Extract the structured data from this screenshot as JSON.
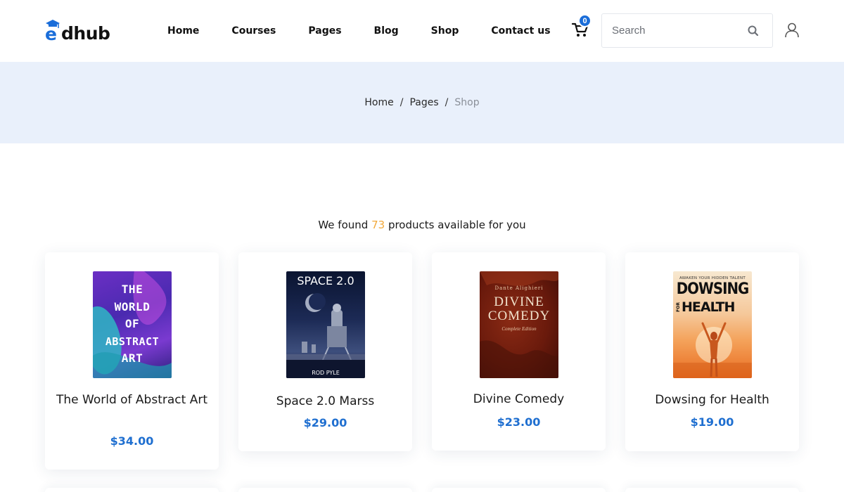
{
  "brand": {
    "logo_text": "dhub",
    "logo_letter": "e"
  },
  "nav": {
    "items": [
      "Home",
      "Courses",
      "Pages",
      "Blog",
      "Shop",
      "Contact us"
    ]
  },
  "cart": {
    "count": "0"
  },
  "search": {
    "placeholder": "Search"
  },
  "breadcrumb": {
    "home": "Home",
    "separator": "/",
    "pages": "Pages",
    "current": "Shop"
  },
  "results": {
    "prefix": "We found",
    "count": "73",
    "suffix": "products available for you"
  },
  "products": [
    {
      "title": "The World of Abstract Art",
      "price": "$34.00",
      "cover_lines": [
        "THE",
        "WORLD",
        "OF",
        "ABSTRACT",
        "ART"
      ]
    },
    {
      "title": "Space 2.0 Marss",
      "price": "$29.00",
      "cover_lines": [
        "SPACE 2.0",
        "ROD PYLE"
      ]
    },
    {
      "title": "Divine Comedy",
      "price": "$23.00",
      "cover_lines": [
        "DIVINE",
        "COMEDY",
        "Dante Alighieri",
        "Complete Edition"
      ]
    },
    {
      "title": "Dowsing for Health",
      "price": "$19.00",
      "cover_lines": [
        "AWAKEN YOUR HIDDEN TALENT",
        "DOWSING",
        "FOR",
        "HEALTH"
      ]
    }
  ],
  "colors": {
    "accent": "#1f6fd0",
    "badge": "#1a6dd9",
    "highlight": "#f2a93b",
    "banner": "#e9f0fb"
  }
}
